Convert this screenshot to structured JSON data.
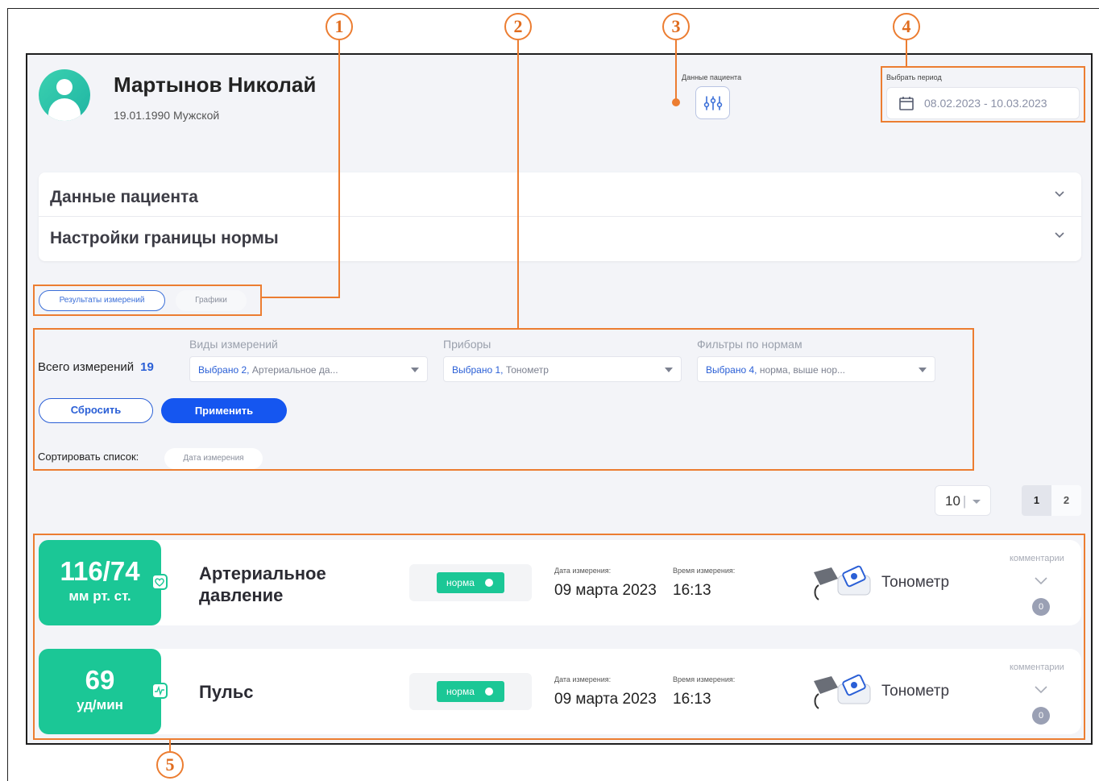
{
  "header": {
    "patient_name": "Мартынов Николай",
    "patient_info": "19.01.1990 Мужской",
    "patient_data_label": "Данные пациента",
    "period_label": "Выбрать период",
    "period_value": "08.02.2023 - 10.03.2023"
  },
  "accordion": {
    "items": [
      {
        "title": "Данные пациента"
      },
      {
        "title": "Настройки границы нормы"
      }
    ]
  },
  "tabs": [
    {
      "label": "Результаты измерений",
      "active": true
    },
    {
      "label": "Графики",
      "active": false
    }
  ],
  "filters": {
    "total_label": "Всего измерений",
    "total_count": "19",
    "groups": [
      {
        "label": "Виды измерений",
        "selected_prefix": "Выбрано 2,",
        "selected_rest": " Артериальное да..."
      },
      {
        "label": "Приборы",
        "selected_prefix": "Выбрано 1,",
        "selected_rest": " Тонометр"
      },
      {
        "label": "Фильтры по нормам",
        "selected_prefix": "Выбрано 4,",
        "selected_rest": " норма, выше нор..."
      }
    ],
    "reset_label": "Сбросить",
    "apply_label": "Применить",
    "sort_label": "Сортировать список:",
    "sort_value": "Дата измерения"
  },
  "pagination": {
    "per_page": "10",
    "pages": [
      "1",
      "2"
    ],
    "current_page": "1"
  },
  "measurements": [
    {
      "value": "116/74",
      "unit": "мм рт. ст.",
      "type_line1": "Артериальное",
      "type_line2": "давление",
      "status": "норма",
      "date_label": "Дата измерения:",
      "date": "09 марта 2023",
      "time_label": "Время измерения:",
      "time": "16:13",
      "device": "Тонометр",
      "comments_label": "комментарии",
      "comments_count": "0"
    },
    {
      "value": "69",
      "unit": "уд/мин",
      "type_line1": "Пульс",
      "type_line2": "",
      "status": "норма",
      "date_label": "Дата измерения:",
      "date": "09 марта 2023",
      "time_label": "Время измерения:",
      "time": "16:13",
      "device": "Тонометр",
      "comments_label": "комментарии",
      "comments_count": "0"
    }
  ],
  "annotations": [
    "1",
    "2",
    "3",
    "4",
    "5"
  ],
  "colors": {
    "accent_blue": "#1556f0",
    "link_blue": "#2a5fd6",
    "norm_green": "#1bc796",
    "annotation_orange": "#ec7d31"
  }
}
